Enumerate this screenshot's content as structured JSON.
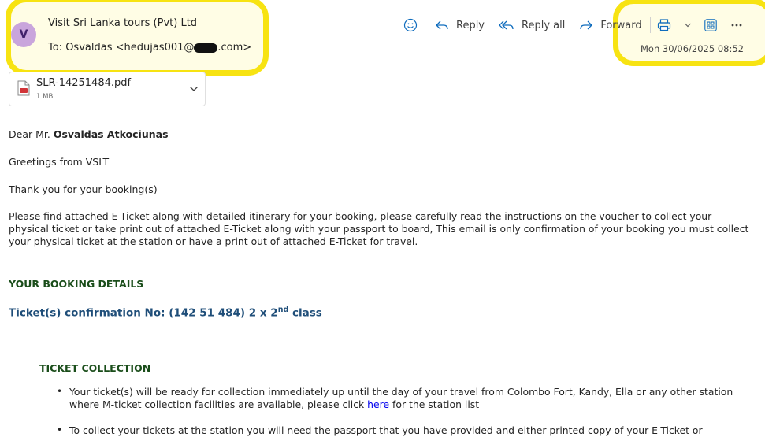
{
  "header": {
    "avatar_letter": "V",
    "sender": "Visit Sri Lanka tours (Pvt) Ltd",
    "to_prefix": "To:  Osvaldas <hedujas001@",
    "to_suffix": ".com>",
    "date": "Mon 30/06/2025 08:52"
  },
  "toolbar": {
    "reply_label": "Reply",
    "reply_all_label": "Reply all",
    "forward_label": "Forward"
  },
  "attachment": {
    "name": "SLR-14251484.pdf",
    "size": "1 MB"
  },
  "body": {
    "greeting_prefix": "Dear Mr. ",
    "greeting_name": "Osvaldas Atkociunas",
    "line_greetings": "Greetings from VSLT",
    "line_thanks": "Thank you for your booking(s)",
    "paragraph": "Please find attached E-Ticket along with detailed itinerary for your booking, please carefully read the instructions on the voucher to collect your physical ticket or take print out of attached E-Ticket along with your passport to board, This email is only confirmation of your booking you must collect your physical ticket at the station or have a print out of attached E-Ticket for travel.",
    "booking_heading": "YOUR BOOKING DETAILS",
    "confirmation_prefix": "Ticket(s) confirmation No: (142 51 484) 2 x 2",
    "confirmation_sup": "nd",
    "confirmation_suffix": " class",
    "collection_heading": "TICKET COLLECTION",
    "bullet1_text": "Your ticket(s) will be ready for collection immediately up until the day of your travel from Colombo Fort, Kandy, Ella or any other station where M-ticket collection facilities are available, please click ",
    "bullet1_link": "here ",
    "bullet1_tail": "for the station list",
    "bullet2_text": "To collect your tickets at the station you will need the passport that you have provided and either printed copy of your E-Ticket or"
  },
  "colors": {
    "highlight": "#f7e312",
    "avatar_bg": "#c9a5dc",
    "heading_green": "#1a4d1a",
    "heading_blue": "#1f4e79",
    "link": "#0000ee"
  }
}
